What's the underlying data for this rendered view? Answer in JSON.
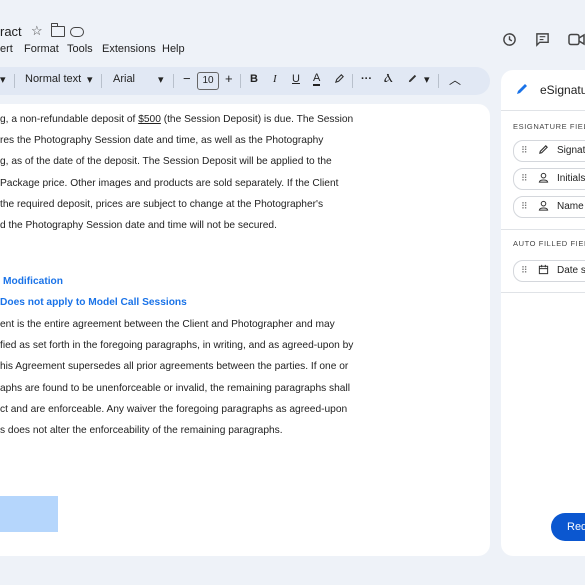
{
  "header": {
    "doc_title": "ract",
    "icons": [
      "star-icon",
      "move-folder-icon",
      "cloud-status-icon",
      "history-icon",
      "comments-icon",
      "meet-icon"
    ]
  },
  "menu": [
    "ert",
    "Format",
    "Tools",
    "Extensions",
    "Help"
  ],
  "toolbar": {
    "style": "Normal text",
    "font": "Arial",
    "font_size": "10",
    "minus": "−",
    "plus": "+",
    "bold": "B",
    "italic": "I",
    "underline": "U",
    "textcolor": "A"
  },
  "document": {
    "lines": [
      {
        "pre": "g, a non-refundable deposit of ",
        "u": "$500",
        "post": " (the Session Deposit) is due. The Session"
      },
      {
        "text": "res the Photography Session date and time, as well as the Photography"
      },
      {
        "text": "g, as of the date of the deposit. The Session Deposit will be applied to the"
      },
      {
        "text": "Package price. Other images and products are sold separately. If the Client"
      },
      {
        "text": "the required deposit, prices are subject to change at the Photographer's"
      },
      {
        "text": "d the Photography Session date and time will not be secured."
      }
    ],
    "heading1": "Modification",
    "heading2": "Does not apply to Model Call Sessions",
    "lines2": [
      "ent is the entire agreement between the Client and Photographer and may",
      "fied as set forth in the foregoing paragraphs, in writing, and as agreed-upon by",
      "his Agreement supersedes all prior agreements between the parties. If one or",
      "aphs are found to be unenforceable or invalid, the remaining paragraphs shall",
      "ct and are enforceable. Any waiver the foregoing paragraphs as agreed-upon",
      "s does not alter the enforceability of the remaining paragraphs."
    ]
  },
  "panel": {
    "title": "eSignatu",
    "section1": "ESIGNATURE FIEL",
    "fields1": [
      {
        "label": "Signat",
        "icon": "pen-icon"
      },
      {
        "label": "Initials",
        "icon": "person-icon"
      },
      {
        "label": "Name",
        "icon": "person-icon"
      }
    ],
    "section2": "AUTO FILLED FIEL",
    "fields2": [
      {
        "label": "Date s",
        "icon": "calendar-icon"
      }
    ],
    "request_button": "Req"
  }
}
